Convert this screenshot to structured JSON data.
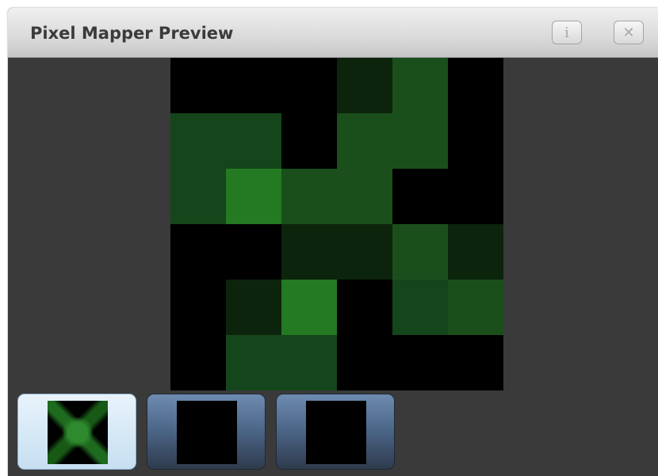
{
  "window": {
    "title": "Pixel Mapper Preview",
    "info_label": "i",
    "close_label": "✕"
  },
  "preview": {
    "colors": {
      "off": "#000000",
      "dark": "#0c240c",
      "mid": "#15451a",
      "mid2": "#1a4f1c",
      "bright": "#237a23"
    },
    "grid": [
      [
        "off",
        "off",
        "off",
        "dark",
        "mid2",
        "off"
      ],
      [
        "mid",
        "mid",
        "off",
        "mid2",
        "mid2",
        "off"
      ],
      [
        "mid",
        "bright",
        "mid2",
        "mid2",
        "off",
        "off"
      ],
      [
        "off",
        "off",
        "dark",
        "dark",
        "mid2",
        "dark"
      ],
      [
        "off",
        "dark",
        "bright",
        "off",
        "mid",
        "mid2"
      ],
      [
        "off",
        "mid",
        "mid",
        "off",
        "off",
        "off"
      ]
    ]
  },
  "thumbnails": [
    {
      "name": "thumbnail-1",
      "active": true
    },
    {
      "name": "thumbnail-2",
      "active": false
    },
    {
      "name": "thumbnail-3",
      "active": false
    }
  ]
}
